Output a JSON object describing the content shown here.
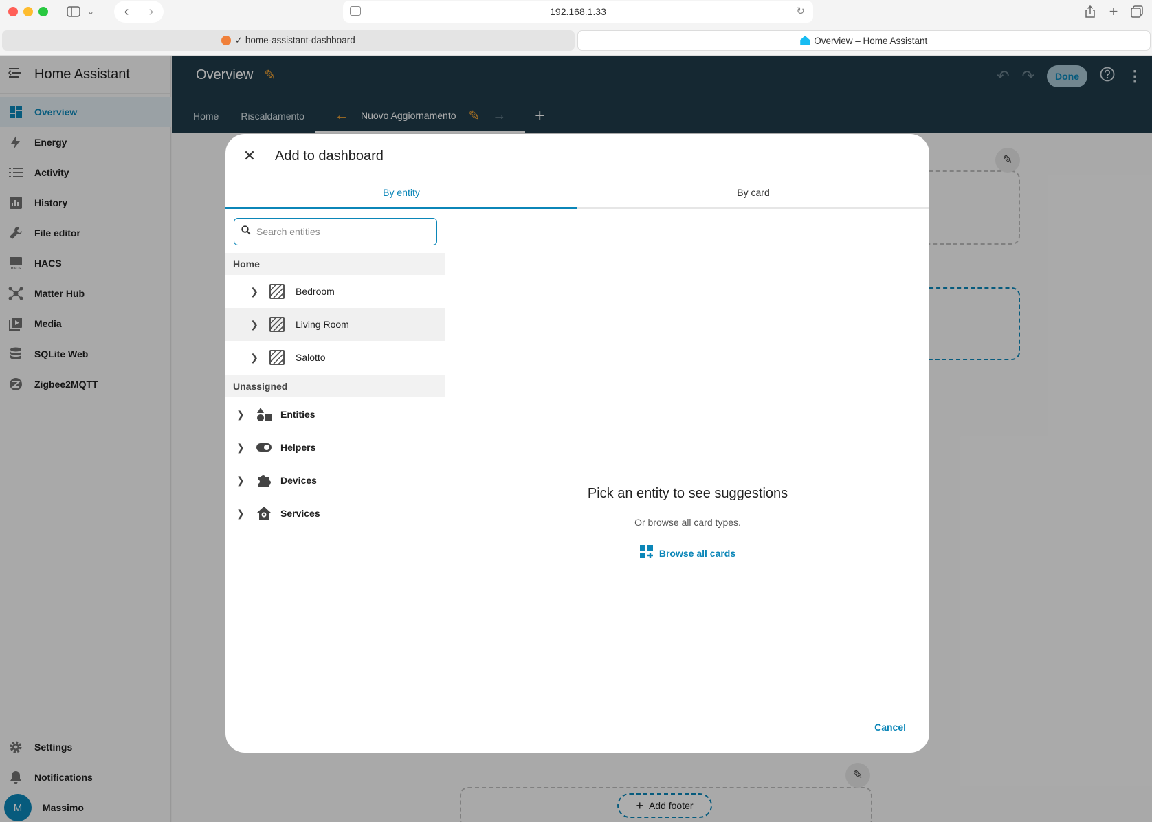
{
  "browser": {
    "url": "192.168.1.33",
    "tabs": [
      {
        "title": "✓ home-assistant-dashboard"
      },
      {
        "title": "Overview – Home Assistant"
      }
    ]
  },
  "sidebar": {
    "title": "Home Assistant",
    "items": [
      {
        "label": "Overview",
        "icon": "dashboard-icon"
      },
      {
        "label": "Energy",
        "icon": "lightning-icon"
      },
      {
        "label": "Activity",
        "icon": "list-icon"
      },
      {
        "label": "History",
        "icon": "chart-icon"
      },
      {
        "label": "File editor",
        "icon": "wrench-icon"
      },
      {
        "label": "HACS",
        "icon": "hacs-icon"
      },
      {
        "label": "Matter Hub",
        "icon": "hub-icon"
      },
      {
        "label": "Media",
        "icon": "media-icon"
      },
      {
        "label": "SQLite Web",
        "icon": "database-icon"
      },
      {
        "label": "Zigbee2MQTT",
        "icon": "zigbee-icon"
      }
    ],
    "bottom": {
      "settings": "Settings",
      "notifications": "Notifications",
      "user_initial": "M",
      "user_name": "Massimo"
    }
  },
  "header": {
    "title": "Overview",
    "done_label": "Done",
    "views": [
      "Home",
      "Riscaldamento",
      "Nuovo Aggiornamento"
    ]
  },
  "dashboard": {
    "add_footer_label": "Add footer"
  },
  "dialog": {
    "title": "Add to dashboard",
    "tabs": [
      "By entity",
      "By card"
    ],
    "search_placeholder": "Search entities",
    "groups": {
      "home": "Home",
      "unassigned": "Unassigned"
    },
    "areas": [
      "Bedroom",
      "Living Room",
      "Salotto"
    ],
    "categories": [
      "Entities",
      "Helpers",
      "Devices",
      "Services"
    ],
    "empty_title": "Pick an entity to see suggestions",
    "empty_subtitle": "Or browse all card types.",
    "browse_label": "Browse all cards",
    "cancel_label": "Cancel"
  },
  "colors": {
    "accent": "#0b86b8",
    "topbar": "#1f3c4a",
    "edit_accent": "#f1a234"
  }
}
